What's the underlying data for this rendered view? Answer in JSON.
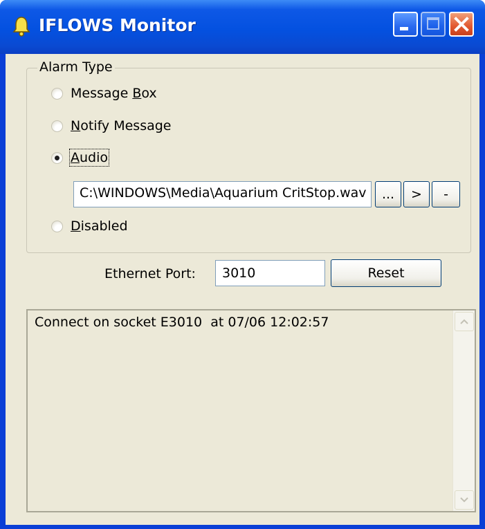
{
  "window": {
    "title": "IFLOWS Monitor",
    "title_icon": "bell-icon",
    "controls": {
      "minimize": "minimize-icon",
      "maximize": "maximize-icon",
      "close": "close-icon"
    }
  },
  "alarm_group": {
    "legend": "Alarm Type",
    "options": [
      {
        "pre": "Message ",
        "key": "B",
        "post": "ox",
        "checked": false
      },
      {
        "pre": "",
        "key": "N",
        "post": "otify Message",
        "checked": false
      },
      {
        "pre": "",
        "key": "A",
        "post": "udio",
        "checked": true
      },
      {
        "pre": "",
        "key": "D",
        "post": "isabled",
        "checked": false
      }
    ],
    "audio_path": "C:\\WINDOWS\\Media\\Aquarium CritStop.wav",
    "browse_label": "...",
    "play_label": ">",
    "stop_label": "-"
  },
  "ethernet": {
    "label": "Ethernet Port:",
    "port_value": "3010",
    "reset_label": "Reset"
  },
  "log": {
    "lines": [
      "Connect on socket E3010  at 07/06 12:02:57"
    ]
  },
  "colors": {
    "titlebar": "#0451e0",
    "client_bg": "#ece9d8",
    "close_button": "#e2582f"
  }
}
